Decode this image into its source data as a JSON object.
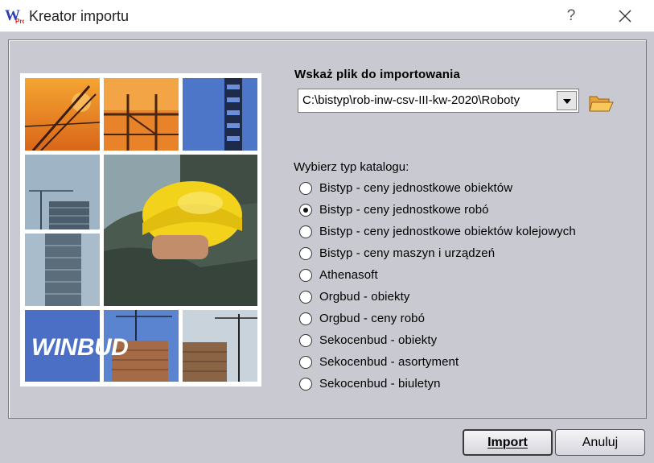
{
  "window": {
    "title": "Kreator importu",
    "help_label": "?",
    "icon": "winbud-app-icon"
  },
  "file_section": {
    "label": "Wskaż plik do importowania",
    "path_value": "C:\\bistyp\\rob-inw-csv-III-kw-2020\\Roboty",
    "folder_icon": "open-folder-icon"
  },
  "catalog": {
    "label": "Wybierz typ katalogu:",
    "options": [
      {
        "label": "Bistyp - ceny jednostkowe obiektów",
        "checked": false
      },
      {
        "label": "Bistyp - ceny jednostkowe robó",
        "checked": true
      },
      {
        "label": "Bistyp - ceny jednostkowe obiektów kolejowych",
        "checked": false
      },
      {
        "label": "Bistyp - ceny maszyn i urządzeń",
        "checked": false
      },
      {
        "label": "Athenasoft",
        "checked": false
      },
      {
        "label": "Orgbud - obiekty",
        "checked": false
      },
      {
        "label": "Orgbud - ceny robó",
        "checked": false
      },
      {
        "label": "Sekocenbud - obiekty",
        "checked": false
      },
      {
        "label": "Sekocenbud - asortyment",
        "checked": false
      },
      {
        "label": "Sekocenbud - biuletyn",
        "checked": false
      }
    ]
  },
  "brand": {
    "logo_text": "WINBUD",
    "colors": {
      "accent_blue": "#4a6fc4",
      "helmet_yellow": "#f2d21a"
    }
  },
  "buttons": {
    "import_label": "Import",
    "cancel_label": "Anuluj"
  }
}
